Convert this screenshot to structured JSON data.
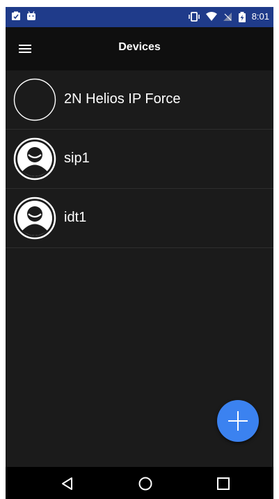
{
  "status_bar": {
    "time": "8:01",
    "left_icons": [
      "clipboard-check-icon",
      "android-icon"
    ],
    "right_icons": [
      "vibrate-icon",
      "wifi-icon",
      "signal-off-icon",
      "battery-charging-icon"
    ]
  },
  "app_bar": {
    "title": "Devices",
    "menu_icon": "hamburger-menu-icon"
  },
  "devices": [
    {
      "name": "2N Helios IP Force",
      "avatar": "empty-circle"
    },
    {
      "name": "sip1",
      "avatar": "person-icon"
    },
    {
      "name": "idt1",
      "avatar": "person-icon"
    }
  ],
  "fab": {
    "icon": "plus-icon",
    "color": "#3b82f0"
  },
  "nav_bar": {
    "buttons": [
      "back-icon",
      "home-icon",
      "recents-icon"
    ]
  },
  "colors": {
    "status_bar": "#1f3b8a",
    "app_bar": "#0f0f0f",
    "background": "#1b1b1b",
    "accent": "#3b82f0"
  }
}
